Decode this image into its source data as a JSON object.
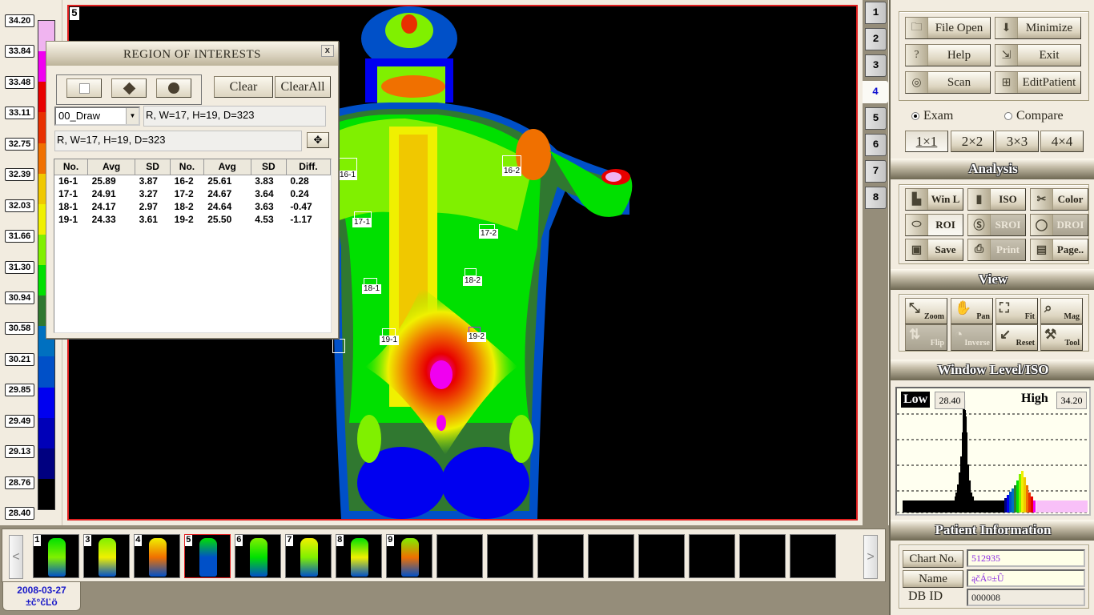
{
  "color_scale": {
    "labels": [
      "34.20",
      "33.84",
      "33.48",
      "33.11",
      "32.75",
      "32.39",
      "32.03",
      "31.66",
      "31.30",
      "30.94",
      "30.58",
      "30.21",
      "29.85",
      "29.49",
      "29.13",
      "28.76",
      "28.40"
    ],
    "colors": [
      "#f0b4f0",
      "#f000f0",
      "#e80000",
      "#e83000",
      "#f07000",
      "#f0c800",
      "#f0f000",
      "#80f000",
      "#00e000",
      "#307830",
      "#0070c0",
      "#0050c8",
      "#0000f0",
      "#0000b8",
      "#000080",
      "#000000"
    ]
  },
  "viewport": {
    "image_index": "5",
    "rois": [
      {
        "label": "16-1"
      },
      {
        "label": "16-2"
      },
      {
        "label": "17-1"
      },
      {
        "label": "17-2"
      },
      {
        "label": "18-1"
      },
      {
        "label": "18-2"
      },
      {
        "label": "19-1"
      },
      {
        "label": "19-2"
      }
    ]
  },
  "roi_dialog": {
    "title": "REGION OF INTERESTS",
    "close_label": "x",
    "clear_label": "Clear",
    "clear_all_label": "ClearAll",
    "draw_mode": "00_Draw",
    "info_top": "R, W=17, H=19, D=323",
    "info_bottom": "R, W=17, H=19, D=323",
    "move_icon": "✥",
    "table": {
      "headers": [
        "No.",
        "Avg",
        "SD",
        "No.",
        "Avg",
        "SD",
        "Diff."
      ],
      "rows": [
        [
          "16-1",
          "25.89",
          "3.87",
          "16-2",
          "25.61",
          "3.83",
          "0.28"
        ],
        [
          "17-1",
          "24.91",
          "3.27",
          "17-2",
          "24.67",
          "3.64",
          "0.24"
        ],
        [
          "18-1",
          "24.17",
          "2.97",
          "18-2",
          "24.64",
          "3.63",
          "-0.47"
        ],
        [
          "19-1",
          "24.33",
          "3.61",
          "19-2",
          "25.50",
          "4.53",
          "-1.17"
        ]
      ]
    }
  },
  "side_tabs": [
    "1",
    "2",
    "3",
    "4",
    "5",
    "6",
    "7",
    "8"
  ],
  "side_tab_active": "4",
  "toolbar": {
    "file_open": "File Open",
    "minimize": "Minimize",
    "help": "Help",
    "exit": "Exit",
    "scan": "Scan",
    "edit_patient": "EditPatient",
    "exam": "Exam",
    "compare": "Compare",
    "layouts": [
      "1×1",
      "2×2",
      "3×3",
      "4×4"
    ]
  },
  "analysis": {
    "title": "Analysis",
    "buttons": [
      "Win L",
      "ISO",
      "Color",
      "ROI",
      "SROI",
      "DROI",
      "Save",
      "Print",
      "Page.."
    ]
  },
  "view": {
    "title": "View",
    "buttons": [
      "Zoom",
      "Pan",
      "Fit",
      "Mag",
      "Flip",
      "Inverse",
      "Reset",
      "Tool"
    ]
  },
  "window_level": {
    "title": "Window Level/ISO",
    "low_label": "Low",
    "low_value": "28.40",
    "high_label": "High",
    "high_value": "34.20"
  },
  "patient_info": {
    "title": "Patient Information",
    "chart_no_label": "Chart No.",
    "chart_no": "512935",
    "name_label": "Name",
    "name": "ąčÁ¤±Û",
    "db_id_label": "DB ID",
    "db_id": "000008"
  },
  "thumbnails": {
    "items": [
      "1",
      "3",
      "4",
      "5",
      "6",
      "7",
      "8",
      "9",
      "",
      "",
      "",
      "",
      "",
      "",
      "",
      ""
    ],
    "selected": "5",
    "prev_label": "<",
    "next_label": ">",
    "date": "2008-03-27",
    "date_sub": "±č°čĽö"
  }
}
